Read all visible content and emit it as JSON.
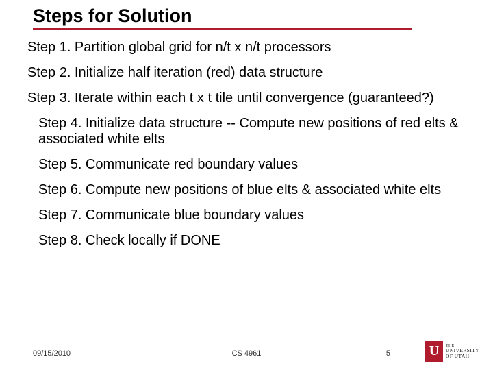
{
  "title": "Steps for Solution",
  "steps": {
    "s1": "Step 1. Partition global grid for n/t x n/t processors",
    "s2": "Step 2. Initialize half iteration (red) data structure",
    "s3": "Step 3. Iterate within each t x t tile until convergence (guaranteed?)",
    "s4": "Step 4. Initialize data structure -- Compute new positions of red elts & associated white elts",
    "s5": "Step 5. Communicate red boundary values",
    "s6": "Step 6. Compute new positions of blue elts & associated white elts",
    "s7": "Step 7. Communicate blue boundary values",
    "s8": "Step 8. Check locally if DONE"
  },
  "footer": {
    "date": "09/15/2010",
    "course": "CS 4961",
    "page": "5",
    "logo_line1": "THE",
    "logo_line2": "UNIVERSITY",
    "logo_line3": "OF UTAH"
  }
}
